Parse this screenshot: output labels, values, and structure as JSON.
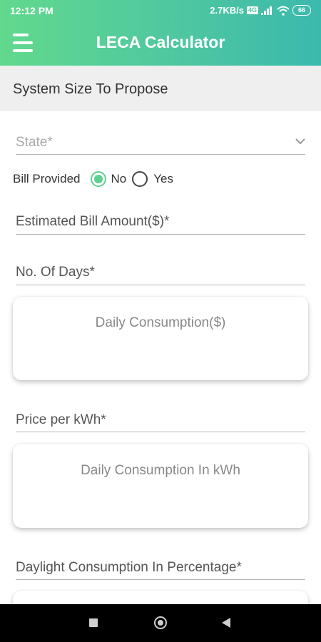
{
  "status_bar": {
    "time": "12:12 PM",
    "network_speed": "2.7KB/s",
    "volte_badge": "4G",
    "battery": "66"
  },
  "header": {
    "title": "LECA Calculator",
    "menu_icon": "hamburger-menu-icon"
  },
  "section": {
    "title": "System Size To Propose"
  },
  "form": {
    "state_label": "State*",
    "bill_provided_label": "Bill Provided",
    "bill_options": {
      "no": "No",
      "yes": "Yes",
      "selected": "No"
    },
    "estimated_bill_label": "Estimated Bill Amount($)*",
    "no_of_days_label": "No. Of Days*",
    "daily_consumption_dollar": "Daily Consumption($)",
    "price_per_kwh_label": "Price per kWh*",
    "daily_consumption_kwh": "Daily Consumption In kWh",
    "daylight_consumption_label": "Daylight Consumption In Percentage*"
  },
  "nav_bar": {
    "recents": "square-icon",
    "home": "circle-icon",
    "back": "triangle-back-icon"
  },
  "colors": {
    "header_gradient_start": "#62d98d",
    "header_gradient_end": "#3bb9ad",
    "radio_checked": "#5fd08f",
    "section_bg": "#efefef"
  }
}
